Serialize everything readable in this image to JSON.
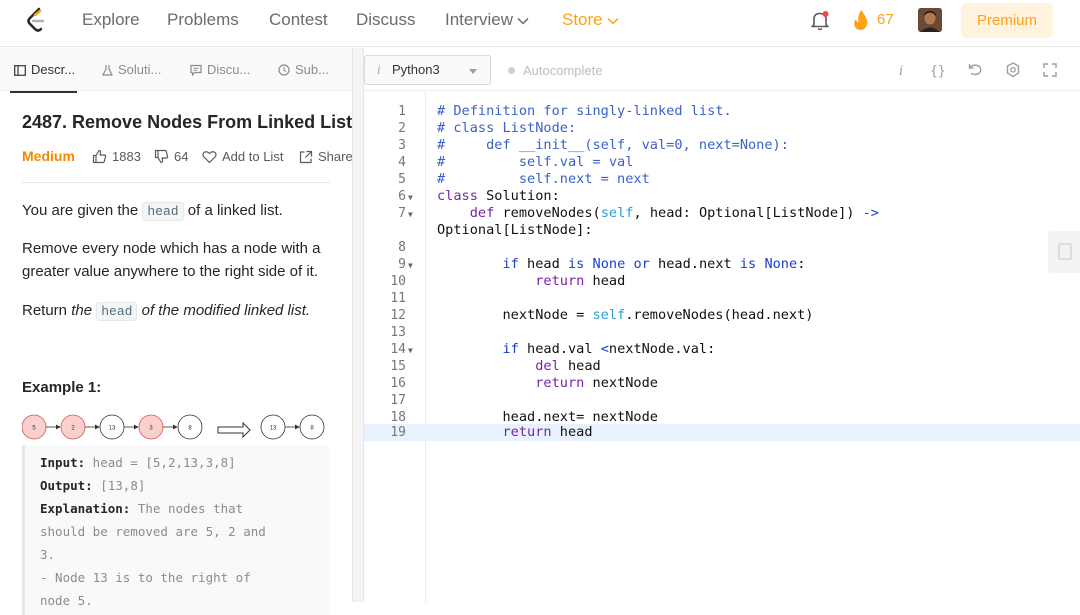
{
  "nav": {
    "items": [
      "Explore",
      "Problems",
      "Contest",
      "Discuss",
      "Interview"
    ],
    "store": "Store",
    "streak": "67",
    "premium": "Premium"
  },
  "tabs": [
    "Descr...",
    "Soluti...",
    "Discu...",
    "Sub..."
  ],
  "problem": {
    "title": "2487. Remove Nodes From Linked List",
    "difficulty": "Medium",
    "likes": "1883",
    "dislikes": "64",
    "add_to_list": "Add to List",
    "share": "Share",
    "p1_pre": "You are given the ",
    "p1_code": "head",
    "p1_post": " of a linked list.",
    "p2": "Remove every node which has a node with a greater value anywhere to the right side of it.",
    "p3_pre": "Return ",
    "p3_the": "the ",
    "p3_code": "head",
    "p3_post": " of the modified linked list.",
    "example_title": "Example 1:",
    "diagram_in": [
      "5",
      "2",
      "13",
      "3",
      "8"
    ],
    "diagram_out": [
      "13",
      "8"
    ],
    "input_label": "Input:",
    "input_value": " head = [5,2,13,3,8]",
    "output_label": "Output:",
    "output_value": " [13,8]",
    "explanation_label": "Explanation:",
    "explanation_l1": " The nodes that",
    "explanation_l2": "should be removed are 5, 2 and",
    "explanation_l3": "3.",
    "explanation_l4": "- Node 13 is to the right of",
    "explanation_l5": "node 5."
  },
  "editor": {
    "language": "Python3",
    "autocomplete": "Autocomplete",
    "line_numbers": [
      "1",
      "2",
      "3",
      "4",
      "5",
      "6",
      "7",
      "",
      "8",
      "9",
      "10",
      "11",
      "12",
      "13",
      "14",
      "15",
      "16",
      "17",
      "18",
      "19"
    ]
  },
  "colors": {
    "accent": "#ffa116",
    "medium": "#ef8b00",
    "node_removed": "#f9d0cd",
    "active_line": "#e8f2ff"
  }
}
